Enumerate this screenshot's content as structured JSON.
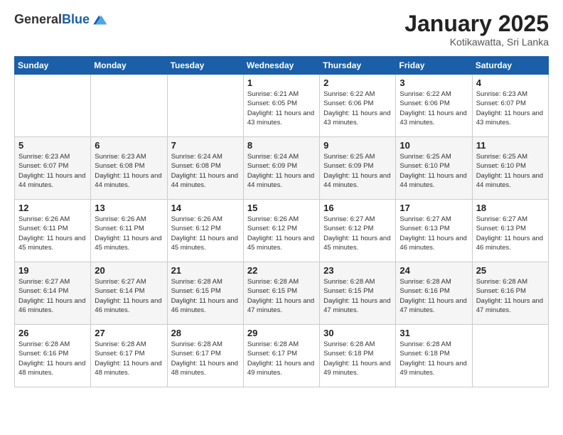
{
  "header": {
    "logo_general": "General",
    "logo_blue": "Blue",
    "month_title": "January 2025",
    "location": "Kotikawatta, Sri Lanka"
  },
  "calendar": {
    "days_of_week": [
      "Sunday",
      "Monday",
      "Tuesday",
      "Wednesday",
      "Thursday",
      "Friday",
      "Saturday"
    ],
    "weeks": [
      [
        {
          "day": "",
          "info": ""
        },
        {
          "day": "",
          "info": ""
        },
        {
          "day": "",
          "info": ""
        },
        {
          "day": "1",
          "info": "Sunrise: 6:21 AM\nSunset: 6:05 PM\nDaylight: 11 hours and 43 minutes."
        },
        {
          "day": "2",
          "info": "Sunrise: 6:22 AM\nSunset: 6:06 PM\nDaylight: 11 hours and 43 minutes."
        },
        {
          "day": "3",
          "info": "Sunrise: 6:22 AM\nSunset: 6:06 PM\nDaylight: 11 hours and 43 minutes."
        },
        {
          "day": "4",
          "info": "Sunrise: 6:23 AM\nSunset: 6:07 PM\nDaylight: 11 hours and 43 minutes."
        }
      ],
      [
        {
          "day": "5",
          "info": "Sunrise: 6:23 AM\nSunset: 6:07 PM\nDaylight: 11 hours and 44 minutes."
        },
        {
          "day": "6",
          "info": "Sunrise: 6:23 AM\nSunset: 6:08 PM\nDaylight: 11 hours and 44 minutes."
        },
        {
          "day": "7",
          "info": "Sunrise: 6:24 AM\nSunset: 6:08 PM\nDaylight: 11 hours and 44 minutes."
        },
        {
          "day": "8",
          "info": "Sunrise: 6:24 AM\nSunset: 6:09 PM\nDaylight: 11 hours and 44 minutes."
        },
        {
          "day": "9",
          "info": "Sunrise: 6:25 AM\nSunset: 6:09 PM\nDaylight: 11 hours and 44 minutes."
        },
        {
          "day": "10",
          "info": "Sunrise: 6:25 AM\nSunset: 6:10 PM\nDaylight: 11 hours and 44 minutes."
        },
        {
          "day": "11",
          "info": "Sunrise: 6:25 AM\nSunset: 6:10 PM\nDaylight: 11 hours and 44 minutes."
        }
      ],
      [
        {
          "day": "12",
          "info": "Sunrise: 6:26 AM\nSunset: 6:11 PM\nDaylight: 11 hours and 45 minutes."
        },
        {
          "day": "13",
          "info": "Sunrise: 6:26 AM\nSunset: 6:11 PM\nDaylight: 11 hours and 45 minutes."
        },
        {
          "day": "14",
          "info": "Sunrise: 6:26 AM\nSunset: 6:12 PM\nDaylight: 11 hours and 45 minutes."
        },
        {
          "day": "15",
          "info": "Sunrise: 6:26 AM\nSunset: 6:12 PM\nDaylight: 11 hours and 45 minutes."
        },
        {
          "day": "16",
          "info": "Sunrise: 6:27 AM\nSunset: 6:12 PM\nDaylight: 11 hours and 45 minutes."
        },
        {
          "day": "17",
          "info": "Sunrise: 6:27 AM\nSunset: 6:13 PM\nDaylight: 11 hours and 46 minutes."
        },
        {
          "day": "18",
          "info": "Sunrise: 6:27 AM\nSunset: 6:13 PM\nDaylight: 11 hours and 46 minutes."
        }
      ],
      [
        {
          "day": "19",
          "info": "Sunrise: 6:27 AM\nSunset: 6:14 PM\nDaylight: 11 hours and 46 minutes."
        },
        {
          "day": "20",
          "info": "Sunrise: 6:27 AM\nSunset: 6:14 PM\nDaylight: 11 hours and 46 minutes."
        },
        {
          "day": "21",
          "info": "Sunrise: 6:28 AM\nSunset: 6:15 PM\nDaylight: 11 hours and 46 minutes."
        },
        {
          "day": "22",
          "info": "Sunrise: 6:28 AM\nSunset: 6:15 PM\nDaylight: 11 hours and 47 minutes."
        },
        {
          "day": "23",
          "info": "Sunrise: 6:28 AM\nSunset: 6:15 PM\nDaylight: 11 hours and 47 minutes."
        },
        {
          "day": "24",
          "info": "Sunrise: 6:28 AM\nSunset: 6:16 PM\nDaylight: 11 hours and 47 minutes."
        },
        {
          "day": "25",
          "info": "Sunrise: 6:28 AM\nSunset: 6:16 PM\nDaylight: 11 hours and 47 minutes."
        }
      ],
      [
        {
          "day": "26",
          "info": "Sunrise: 6:28 AM\nSunset: 6:16 PM\nDaylight: 11 hours and 48 minutes."
        },
        {
          "day": "27",
          "info": "Sunrise: 6:28 AM\nSunset: 6:17 PM\nDaylight: 11 hours and 48 minutes."
        },
        {
          "day": "28",
          "info": "Sunrise: 6:28 AM\nSunset: 6:17 PM\nDaylight: 11 hours and 48 minutes."
        },
        {
          "day": "29",
          "info": "Sunrise: 6:28 AM\nSunset: 6:17 PM\nDaylight: 11 hours and 49 minutes."
        },
        {
          "day": "30",
          "info": "Sunrise: 6:28 AM\nSunset: 6:18 PM\nDaylight: 11 hours and 49 minutes."
        },
        {
          "day": "31",
          "info": "Sunrise: 6:28 AM\nSunset: 6:18 PM\nDaylight: 11 hours and 49 minutes."
        },
        {
          "day": "",
          "info": ""
        }
      ]
    ]
  }
}
